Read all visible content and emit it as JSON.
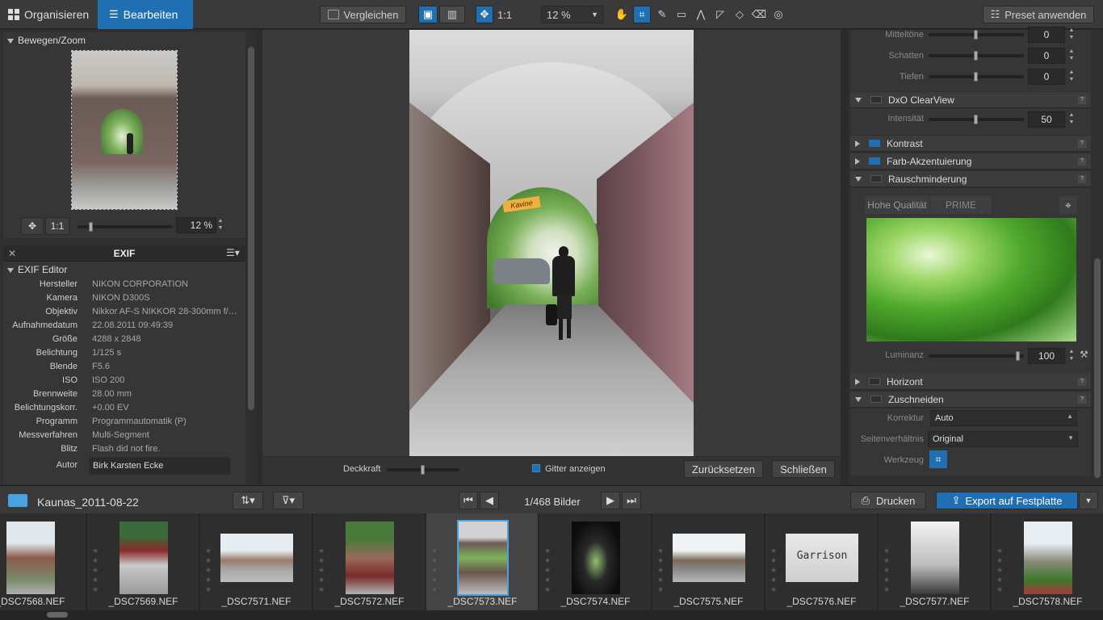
{
  "topbar": {
    "organize_label": "Organisieren",
    "edit_label": "Bearbeiten",
    "compare_label": "Vergleichen",
    "one_to_one": "1:1",
    "zoom": "12 %",
    "preset_label": "Preset anwenden"
  },
  "left": {
    "move_zoom_title": "Bewegen/Zoom",
    "nav_one_to_one": "1:1",
    "nav_zoom": "12 %",
    "exif_tab": "EXIF",
    "exif_editor_title": "EXIF Editor",
    "exif": [
      {
        "k": "Hersteller",
        "v": "NIKON CORPORATION"
      },
      {
        "k": "Kamera",
        "v": "NIKON D300S"
      },
      {
        "k": "Objektiv",
        "v": "Nikkor AF-S NIKKOR 28-300mm f/…"
      },
      {
        "k": "Aufnahmedatum",
        "v": "22.08.2011 09:49:39"
      },
      {
        "k": "Größe",
        "v": "4288 x 2848"
      },
      {
        "k": "Belichtung",
        "v": "1/125 s"
      },
      {
        "k": "Blende",
        "v": "F5.6"
      },
      {
        "k": "ISO",
        "v": "ISO 200"
      },
      {
        "k": "Brennweite",
        "v": "28.00 mm"
      },
      {
        "k": "Belichtungskorr.",
        "v": "+0.00 EV"
      },
      {
        "k": "Programm",
        "v": "Programmautomatik (P)"
      },
      {
        "k": "Messverfahren",
        "v": "Multi-Segment"
      },
      {
        "k": "Blitz",
        "v": "Flash did not fire."
      }
    ],
    "author_label": "Autor",
    "author_value": "Birk Karsten Ecke"
  },
  "center": {
    "sign_text": "Kavinė",
    "opacity_label": "Deckkraft",
    "grid_label": "Gitter anzeigen",
    "reset_label": "Zurücksetzen",
    "close_label": "Schließen"
  },
  "right": {
    "rows_top": [
      {
        "label": "Mitteltöne",
        "value": "0"
      },
      {
        "label": "Schatten",
        "value": "0"
      },
      {
        "label": "Tiefen",
        "value": "0"
      }
    ],
    "clearview_title": "DxO ClearView",
    "intensity_label": "Intensität",
    "intensity_value": "50",
    "contrast_title": "Kontrast",
    "color_accent_title": "Farb-Akzentuierung",
    "noise_title": "Rauschminderung",
    "noise_high": "Hohe Qualität",
    "noise_prime": "PRIME",
    "luminance_label": "Luminanz",
    "luminance_value": "100",
    "horizon_title": "Horizont",
    "crop_title": "Zuschneiden",
    "correction_label": "Korrektur",
    "correction_value": "Auto",
    "ratio_label": "Seitenverhältnis",
    "ratio_value": "Original",
    "tool_label": "Werkzeug",
    "help": "?"
  },
  "filmstrip_bar": {
    "folder": "Kaunas_2011-08-22",
    "count": "1/468 Bilder",
    "print_label": "Drucken",
    "export_label": "Export auf Festplatte"
  },
  "thumbs": [
    {
      "name": "_DSC7568.NEF"
    },
    {
      "name": "_DSC7569.NEF"
    },
    {
      "name": "_DSC7571.NEF"
    },
    {
      "name": "_DSC7572.NEF"
    },
    {
      "name": "_DSC7573.NEF"
    },
    {
      "name": "_DSC7574.NEF"
    },
    {
      "name": "_DSC7575.NEF"
    },
    {
      "name": "_DSC7576.NEF"
    },
    {
      "name": "_DSC7577.NEF"
    },
    {
      "name": "_DSC7578.NEF"
    }
  ],
  "thumb_sign": "Garrison",
  "colors": {
    "accent": "#1f6fb2"
  }
}
